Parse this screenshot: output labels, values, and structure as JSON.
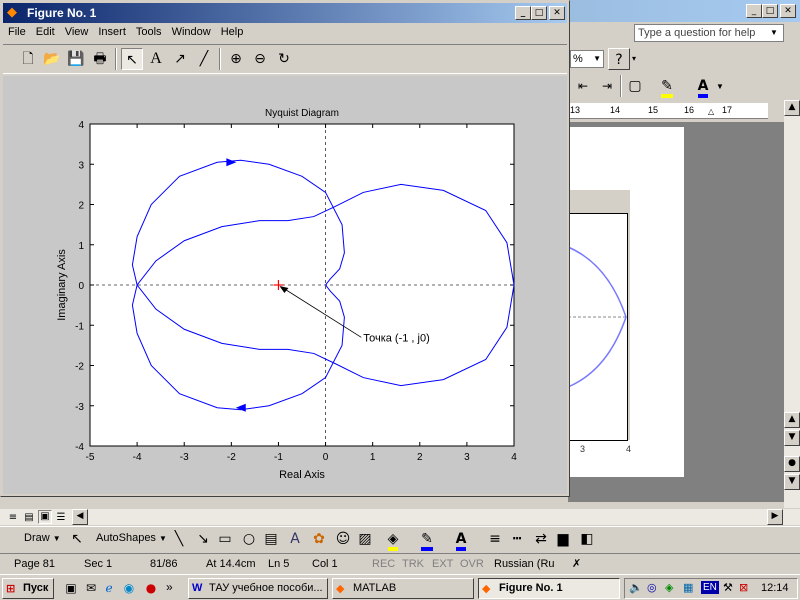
{
  "word": {
    "help_placeholder": "Type a question for help",
    "zoom_fragment": "%",
    "ruler_ticks": [
      "13",
      "14",
      "15",
      "16",
      "17"
    ],
    "doc_tick_labels": [
      "3",
      "4"
    ],
    "drawbar": {
      "draw_label": "Draw",
      "autoshapes_label": "AutoShapes"
    },
    "status": {
      "page": "Page 81",
      "sec": "Sec 1",
      "pages": "81/86",
      "at": "At 14.4cm",
      "ln": "Ln 5",
      "col": "Col 1",
      "rec": "REC",
      "trk": "TRK",
      "ext": "EXT",
      "ovr": "OVR",
      "language": "Russian (Ru"
    }
  },
  "figure": {
    "window_title": "Figure No. 1",
    "menu": [
      "File",
      "Edit",
      "View",
      "Insert",
      "Tools",
      "Window",
      "Help"
    ]
  },
  "chart_data": {
    "type": "line",
    "title": "Nyquist Diagram",
    "xlabel": "Real Axis",
    "ylabel": "Imaginary Axis",
    "xlim": [
      -5,
      4
    ],
    "ylim": [
      -4,
      4
    ],
    "xticks": [
      -5,
      -4,
      -3,
      -2,
      -1,
      0,
      1,
      2,
      3,
      4
    ],
    "yticks": [
      -4,
      -3,
      -2,
      -1,
      0,
      1,
      2,
      3,
      4
    ],
    "series": [
      {
        "color": "#0000ff",
        "points": [
          [
            4,
            0
          ],
          [
            3.85,
            1.05
          ],
          [
            3.4,
            1.85
          ],
          [
            2.5,
            2.35
          ],
          [
            1.6,
            2.5
          ],
          [
            0.8,
            2.3
          ],
          [
            0.2,
            1.95
          ],
          [
            -0.25,
            1.7
          ],
          [
            -0.8,
            1.6
          ],
          [
            -1.4,
            1.6
          ],
          [
            -2.2,
            1.45
          ],
          [
            -3,
            1.1
          ],
          [
            -3.6,
            0.6
          ],
          [
            -4,
            0
          ],
          [
            -4.1,
            -0.5
          ],
          [
            -4,
            -1.2
          ],
          [
            -3.7,
            -2
          ],
          [
            -3.1,
            -2.7
          ],
          [
            -2.3,
            -3.05
          ],
          [
            -1.8,
            -3.1
          ],
          [
            -1.2,
            -3
          ],
          [
            -0.5,
            -2.7
          ],
          [
            0,
            -2.3
          ],
          [
            0.35,
            -1.5
          ],
          [
            0.4,
            -0.8
          ],
          [
            0.3,
            -0.4
          ],
          [
            0.1,
            -0.15
          ],
          [
            0,
            0
          ],
          [
            0.1,
            0.15
          ],
          [
            0.3,
            0.4
          ],
          [
            0.4,
            0.8
          ],
          [
            0.35,
            1.5
          ],
          [
            0,
            2.3
          ],
          [
            -0.5,
            2.7
          ],
          [
            -1.2,
            3
          ],
          [
            -1.8,
            3.1
          ],
          [
            -2.3,
            3.05
          ],
          [
            -3.1,
            2.7
          ],
          [
            -3.7,
            2
          ],
          [
            -4,
            1.2
          ],
          [
            -4.1,
            0.5
          ],
          [
            -4,
            0
          ],
          [
            -3.6,
            -0.6
          ],
          [
            -3,
            -1.1
          ],
          [
            -2.2,
            -1.45
          ],
          [
            -1.4,
            -1.6
          ],
          [
            -0.8,
            -1.6
          ],
          [
            -0.25,
            -1.7
          ],
          [
            0.2,
            -1.95
          ],
          [
            0.8,
            -2.3
          ],
          [
            1.6,
            -2.5
          ],
          [
            2.5,
            -2.35
          ],
          [
            3.4,
            -1.85
          ],
          [
            3.85,
            -1.05
          ],
          [
            4,
            0
          ]
        ]
      }
    ],
    "arrows": [
      {
        "x": -2,
        "y": 3.05,
        "direction": "right"
      },
      {
        "x": -1.8,
        "y": -3.05,
        "direction": "left"
      }
    ],
    "marker": {
      "x": -1,
      "y": 0,
      "symbol": "+",
      "color": "#ff0000"
    },
    "annotation": {
      "text": "Точка (-1 , j0)",
      "x": 0.8,
      "y": -1.3,
      "points_to": [
        -1,
        0
      ]
    },
    "grid": false,
    "crosshair": true
  },
  "taskbar": {
    "start_label": "Пуск",
    "more_label": "»",
    "buttons": [
      "ТАУ учебное пособи...",
      "MATLAB",
      "Figure No. 1"
    ],
    "tray_lang": "EN",
    "clock": "12:14"
  }
}
